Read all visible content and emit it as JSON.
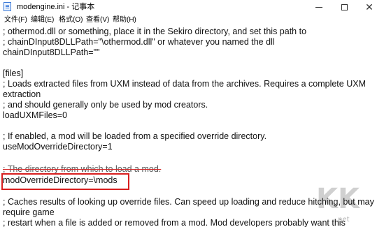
{
  "window": {
    "title": "modengine.ini - 记事本",
    "app_icon": "notepad-icon",
    "controls": {
      "minimize": "─",
      "maximize": "☐",
      "close": "✕"
    }
  },
  "menu": {
    "items": [
      "文件(F)",
      "编辑(E)",
      "格式(O)",
      "查看(V)",
      "帮助(H)"
    ]
  },
  "document": {
    "lines": [
      "; othermod.dll or something, place it in the Sekiro directory, and set this path to",
      "; chainDInput8DLLPath=\"\\othermod.dll\" or whatever you named the dll",
      "chainDInput8DLLPath=\"\"",
      "",
      "[files]",
      "; Loads extracted files from UXM instead of data from the archives. Requires a complete UXM",
      "extraction",
      "; and should generally only be used by mod creators.",
      "loadUXMFiles=0",
      "",
      "; If enabled, a mod will be loaded from a specified override directory.",
      "useModOverrideDirectory=1",
      "",
      "; The directory from which to load a mod.",
      "modOverrideDirectory=\\mods",
      "",
      "; Caches results of looking up override files. Can speed up loading and reduce hitching, but may",
      "require game",
      "; restart when a file is added or removed from a mod. Mod developers probably want this"
    ],
    "highlighted_line": "modOverrideDirectory=\\mods",
    "highlight_color": "#d81e1e"
  },
  "watermark": {
    "text": "KK",
    "url": ".net"
  }
}
